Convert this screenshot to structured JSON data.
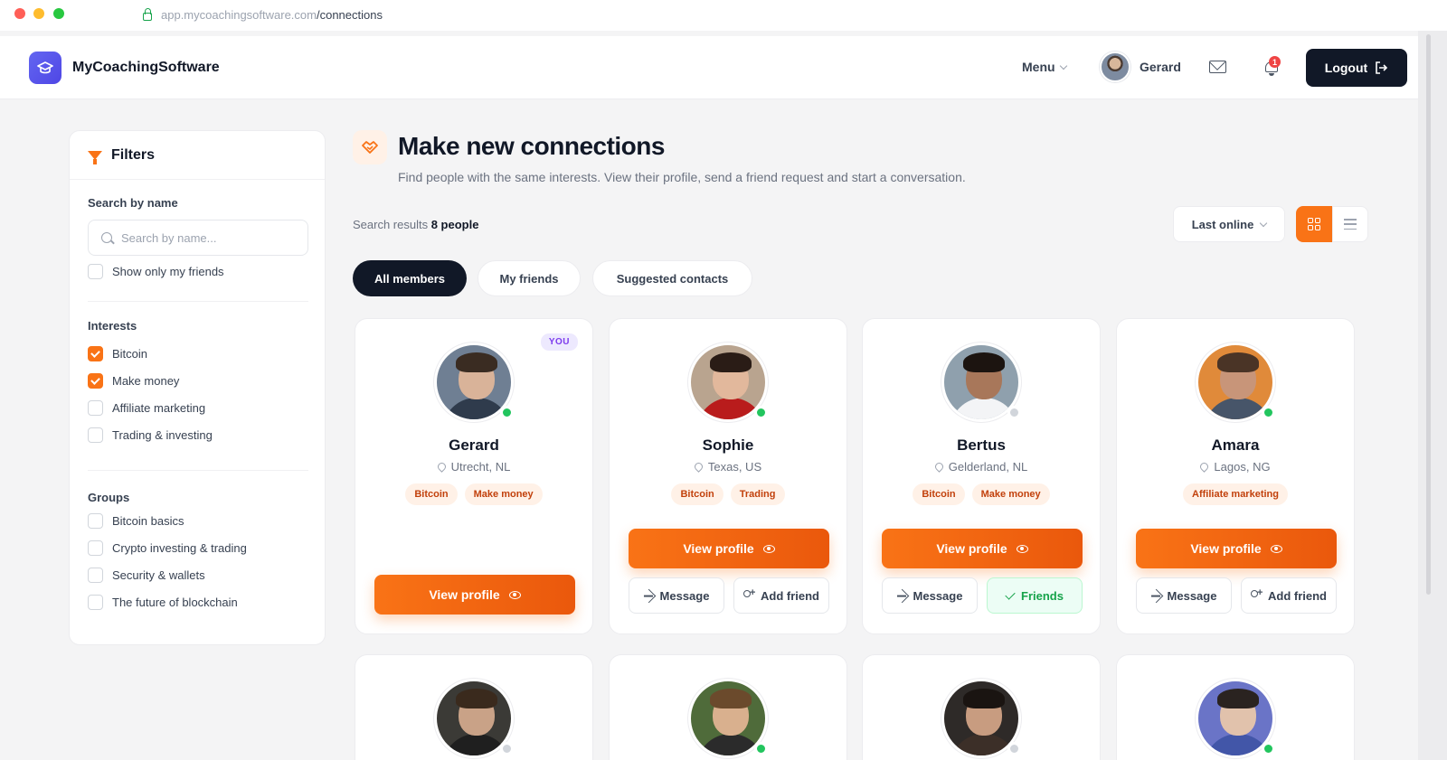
{
  "browser": {
    "url_host": "app.mycoachingsoftware.com",
    "url_path": "/connections"
  },
  "header": {
    "app_name": "MyCoachingSoftware",
    "menu_label": "Menu",
    "user_name": "Gerard",
    "notification_count": "1",
    "logout_label": "Logout"
  },
  "filters": {
    "title": "Filters",
    "search_label": "Search by name",
    "search_placeholder": "Search by name...",
    "search_value": "",
    "only_friends_label": "Show only my friends",
    "interests_title": "Interests",
    "interests": [
      {
        "label": "Bitcoin",
        "checked": true
      },
      {
        "label": "Make money",
        "checked": true
      },
      {
        "label": "Affiliate marketing",
        "checked": false
      },
      {
        "label": "Trading & investing",
        "checked": false
      }
    ],
    "groups_title": "Groups",
    "groups": [
      {
        "label": "Bitcoin basics",
        "checked": false
      },
      {
        "label": "Crypto investing & trading",
        "checked": false
      },
      {
        "label": "Security & wallets",
        "checked": false
      },
      {
        "label": "The future of blockchain",
        "checked": false
      }
    ]
  },
  "main": {
    "title": "Make new connections",
    "subtitle": "Find people with the same interests. View their profile, send a friend request and start a conversation.",
    "results_prefix": "Search results",
    "results_count": "8 people",
    "sort_value": "Last online",
    "tabs": [
      "All members",
      "My friends",
      "Suggested contacts"
    ],
    "active_tab": "All members"
  },
  "labels": {
    "you_badge": "YOU",
    "view_profile": "View profile",
    "message": "Message",
    "add_friend": "Add friend",
    "friends": "Friends"
  },
  "people": [
    {
      "name": "Gerard",
      "location": "Utrecht, NL",
      "tags": [
        "Bitcoin",
        "Make money"
      ],
      "online": true,
      "is_you": true,
      "relation": "self"
    },
    {
      "name": "Sophie",
      "location": "Texas, US",
      "tags": [
        "Bitcoin",
        "Trading"
      ],
      "online": true,
      "is_you": false,
      "relation": "none"
    },
    {
      "name": "Bertus",
      "location": "Gelderland, NL",
      "tags": [
        "Bitcoin",
        "Make money"
      ],
      "online": false,
      "is_you": false,
      "relation": "friends"
    },
    {
      "name": "Amara",
      "location": "Lagos, NG",
      "tags": [
        "Affiliate marketing"
      ],
      "online": true,
      "is_you": false,
      "relation": "none"
    }
  ],
  "more_people": [
    {
      "online": false
    },
    {
      "online": true
    },
    {
      "online": false
    },
    {
      "online": true
    }
  ],
  "colors": {
    "accent": "#f97316",
    "dark": "#111827",
    "online": "#22c55e",
    "brand": "#4f46e5"
  }
}
